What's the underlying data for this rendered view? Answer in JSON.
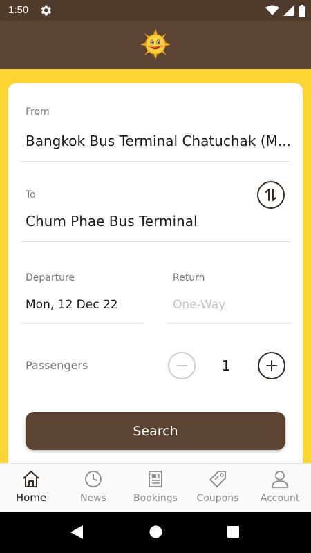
{
  "status_bar": {
    "time": "1:50",
    "icons": [
      "settings-gear-icon",
      "wifi-icon",
      "cellular-signal-icon",
      "battery-icon"
    ]
  },
  "header": {
    "logo": "sun-mascot-logo"
  },
  "form": {
    "from_label": "From",
    "from_value": "Bangkok Bus Terminal Chatuchak (M...",
    "to_label": "To",
    "to_value": "Chum Phae Bus Terminal",
    "swap_icon": "swap-vertical-icon",
    "departure_label": "Departure",
    "departure_value": "Mon, 12 Dec 22",
    "return_label": "Return",
    "return_placeholder": "One-Way",
    "passengers_label": "Passengers",
    "passengers_count": "1",
    "search_label": "Search"
  },
  "bottom_nav": {
    "items": [
      {
        "label": "Home",
        "icon": "home-icon",
        "active": true
      },
      {
        "label": "News",
        "icon": "clock-icon",
        "active": false
      },
      {
        "label": "Bookings",
        "icon": "ticket-icon",
        "active": false
      },
      {
        "label": "Coupons",
        "icon": "tag-icon",
        "active": false
      },
      {
        "label": "Account",
        "icon": "person-icon",
        "active": false
      }
    ]
  },
  "colors": {
    "brand_brown": "#5b4431",
    "brand_yellow": "#fcd433",
    "status_bar": "#4e3b2c"
  }
}
